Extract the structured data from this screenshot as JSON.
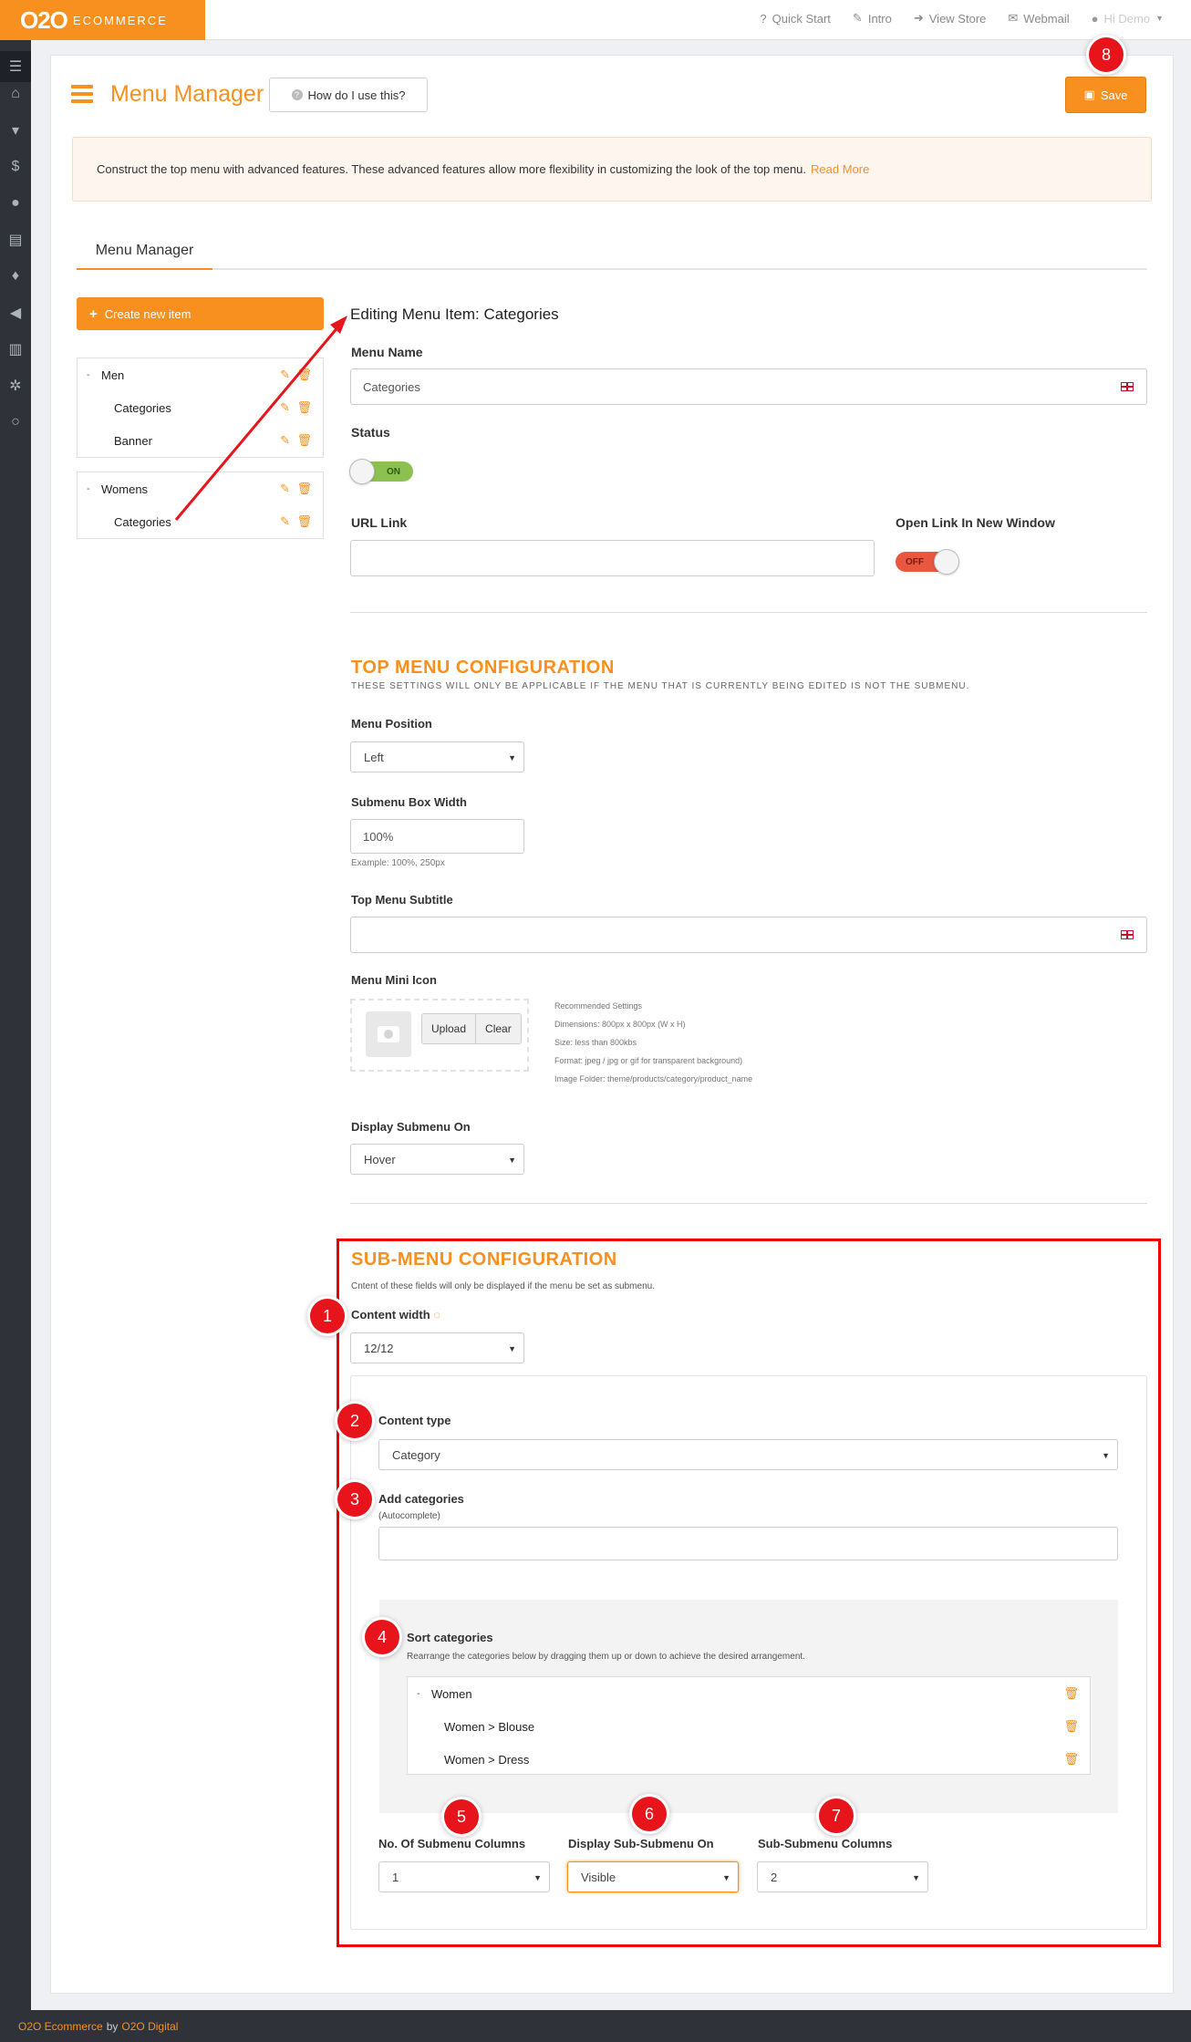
{
  "app": {
    "brand": "O2O",
    "brand_sub": "ECOMMERCE"
  },
  "topnav": [
    {
      "label": "Quick Start",
      "icon": "question-icon"
    },
    {
      "label": "Intro",
      "icon": "pencil-icon"
    },
    {
      "label": "View Store",
      "icon": "signin-icon"
    },
    {
      "label": "Webmail",
      "icon": "mail-icon"
    }
  ],
  "user": {
    "label": "Hi Demo"
  },
  "header": {
    "title": "Menu Manager",
    "help_label": "How do I use this?",
    "save_label": "Save"
  },
  "notice": {
    "text": "Construct the top menu with advanced features. These advanced features allow more flexibility in customizing the look of the top menu.",
    "link": "Read More"
  },
  "tabs": {
    "active": "Menu Manager"
  },
  "sidebar": {
    "create_label": "Create new item",
    "groups": [
      {
        "label": "Men",
        "children": [
          "Categories",
          "Banner"
        ]
      },
      {
        "label": "Womens",
        "children": [
          "Categories"
        ]
      }
    ]
  },
  "editor": {
    "heading": "Editing Menu Item: Categories",
    "menu_name_label": "Menu Name",
    "menu_name_value": "Categories",
    "status_label": "Status",
    "status_value": "ON",
    "url_label": "URL Link",
    "url_value": "",
    "new_window_label": "Open Link In New Window",
    "new_window_value": "OFF"
  },
  "top_menu": {
    "title": "TOP MENU CONFIGURATION",
    "subtitle": "THESE SETTINGS WILL ONLY BE APPLICABLE IF THE MENU THAT IS CURRENTLY BEING EDITED IS NOT THE SUBMENU.",
    "position_label": "Menu Position",
    "position_value": "Left",
    "box_width_label": "Submenu Box Width",
    "box_width_value": "100%",
    "box_width_hint": "Example: 100%, 250px",
    "subtitle_label": "Top Menu Subtitle",
    "subtitle_value": "",
    "icon_label": "Menu Mini Icon",
    "upload_label": "Upload",
    "clear_label": "Clear",
    "rec_title": "Recommended Settings",
    "rec_lines": [
      "Dimensions: 800px x 800px (W x H)",
      "Size: less than 800kbs",
      "Format: jpeg / jpg or gif for transparent background)",
      "Image Folder: theme/products/category/product_name"
    ],
    "display_on_label": "Display Submenu On",
    "display_on_value": "Hover"
  },
  "sub_menu": {
    "title": "SUB-MENU CONFIGURATION",
    "subtitle": "Cntent of these fields will only be displayed if the menu be set as submenu.",
    "content_width_label": "Content width",
    "content_width_value": "12/12",
    "content_type_label": "Content type",
    "content_type_value": "Category",
    "add_categories_label": "Add categories",
    "add_categories_hint": "(Autocomplete)",
    "add_categories_value": "",
    "sort_label": "Sort categories",
    "sort_hint": "Rearrange the categories below by dragging them up or down to achieve the desired arrangement.",
    "sort_parent": "Women",
    "sort_children": [
      "Women > Blouse",
      "Women > Dress"
    ],
    "columns_label": "No. Of Submenu Columns",
    "columns_value": "1",
    "display_sub_label": "Display Sub-Submenu On",
    "display_sub_value": "Visible",
    "sub_columns_label": "Sub-Submenu Columns",
    "sub_columns_value": "2"
  },
  "annotations": [
    "1",
    "2",
    "3",
    "4",
    "5",
    "6",
    "7",
    "8"
  ],
  "footer": {
    "brand": "O2O Ecommerce",
    "by": "by",
    "company": "O2O Digital"
  },
  "colors": {
    "accent": "#f7901e",
    "annotation_red": "#e8141b",
    "sidebar_dark": "#2f3238"
  }
}
